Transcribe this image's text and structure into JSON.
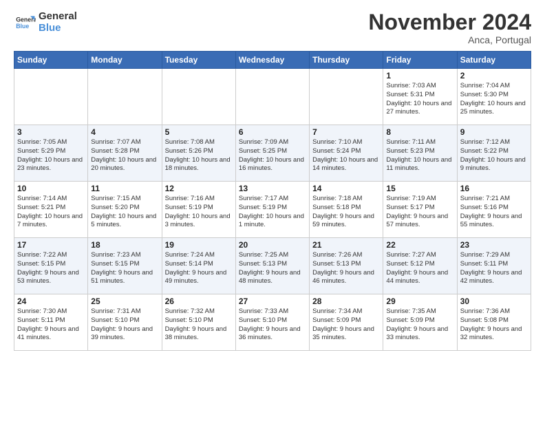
{
  "logo": {
    "line1": "General",
    "line2": "Blue"
  },
  "title": "November 2024",
  "location": "Anca, Portugal",
  "days_header": [
    "Sunday",
    "Monday",
    "Tuesday",
    "Wednesday",
    "Thursday",
    "Friday",
    "Saturday"
  ],
  "weeks": [
    [
      {
        "day": "",
        "info": ""
      },
      {
        "day": "",
        "info": ""
      },
      {
        "day": "",
        "info": ""
      },
      {
        "day": "",
        "info": ""
      },
      {
        "day": "",
        "info": ""
      },
      {
        "day": "1",
        "info": "Sunrise: 7:03 AM\nSunset: 5:31 PM\nDaylight: 10 hours and 27 minutes."
      },
      {
        "day": "2",
        "info": "Sunrise: 7:04 AM\nSunset: 5:30 PM\nDaylight: 10 hours and 25 minutes."
      }
    ],
    [
      {
        "day": "3",
        "info": "Sunrise: 7:05 AM\nSunset: 5:29 PM\nDaylight: 10 hours and 23 minutes."
      },
      {
        "day": "4",
        "info": "Sunrise: 7:07 AM\nSunset: 5:28 PM\nDaylight: 10 hours and 20 minutes."
      },
      {
        "day": "5",
        "info": "Sunrise: 7:08 AM\nSunset: 5:26 PM\nDaylight: 10 hours and 18 minutes."
      },
      {
        "day": "6",
        "info": "Sunrise: 7:09 AM\nSunset: 5:25 PM\nDaylight: 10 hours and 16 minutes."
      },
      {
        "day": "7",
        "info": "Sunrise: 7:10 AM\nSunset: 5:24 PM\nDaylight: 10 hours and 14 minutes."
      },
      {
        "day": "8",
        "info": "Sunrise: 7:11 AM\nSunset: 5:23 PM\nDaylight: 10 hours and 11 minutes."
      },
      {
        "day": "9",
        "info": "Sunrise: 7:12 AM\nSunset: 5:22 PM\nDaylight: 10 hours and 9 minutes."
      }
    ],
    [
      {
        "day": "10",
        "info": "Sunrise: 7:14 AM\nSunset: 5:21 PM\nDaylight: 10 hours and 7 minutes."
      },
      {
        "day": "11",
        "info": "Sunrise: 7:15 AM\nSunset: 5:20 PM\nDaylight: 10 hours and 5 minutes."
      },
      {
        "day": "12",
        "info": "Sunrise: 7:16 AM\nSunset: 5:19 PM\nDaylight: 10 hours and 3 minutes."
      },
      {
        "day": "13",
        "info": "Sunrise: 7:17 AM\nSunset: 5:19 PM\nDaylight: 10 hours and 1 minute."
      },
      {
        "day": "14",
        "info": "Sunrise: 7:18 AM\nSunset: 5:18 PM\nDaylight: 9 hours and 59 minutes."
      },
      {
        "day": "15",
        "info": "Sunrise: 7:19 AM\nSunset: 5:17 PM\nDaylight: 9 hours and 57 minutes."
      },
      {
        "day": "16",
        "info": "Sunrise: 7:21 AM\nSunset: 5:16 PM\nDaylight: 9 hours and 55 minutes."
      }
    ],
    [
      {
        "day": "17",
        "info": "Sunrise: 7:22 AM\nSunset: 5:15 PM\nDaylight: 9 hours and 53 minutes."
      },
      {
        "day": "18",
        "info": "Sunrise: 7:23 AM\nSunset: 5:15 PM\nDaylight: 9 hours and 51 minutes."
      },
      {
        "day": "19",
        "info": "Sunrise: 7:24 AM\nSunset: 5:14 PM\nDaylight: 9 hours and 49 minutes."
      },
      {
        "day": "20",
        "info": "Sunrise: 7:25 AM\nSunset: 5:13 PM\nDaylight: 9 hours and 48 minutes."
      },
      {
        "day": "21",
        "info": "Sunrise: 7:26 AM\nSunset: 5:13 PM\nDaylight: 9 hours and 46 minutes."
      },
      {
        "day": "22",
        "info": "Sunrise: 7:27 AM\nSunset: 5:12 PM\nDaylight: 9 hours and 44 minutes."
      },
      {
        "day": "23",
        "info": "Sunrise: 7:29 AM\nSunset: 5:11 PM\nDaylight: 9 hours and 42 minutes."
      }
    ],
    [
      {
        "day": "24",
        "info": "Sunrise: 7:30 AM\nSunset: 5:11 PM\nDaylight: 9 hours and 41 minutes."
      },
      {
        "day": "25",
        "info": "Sunrise: 7:31 AM\nSunset: 5:10 PM\nDaylight: 9 hours and 39 minutes."
      },
      {
        "day": "26",
        "info": "Sunrise: 7:32 AM\nSunset: 5:10 PM\nDaylight: 9 hours and 38 minutes."
      },
      {
        "day": "27",
        "info": "Sunrise: 7:33 AM\nSunset: 5:10 PM\nDaylight: 9 hours and 36 minutes."
      },
      {
        "day": "28",
        "info": "Sunrise: 7:34 AM\nSunset: 5:09 PM\nDaylight: 9 hours and 35 minutes."
      },
      {
        "day": "29",
        "info": "Sunrise: 7:35 AM\nSunset: 5:09 PM\nDaylight: 9 hours and 33 minutes."
      },
      {
        "day": "30",
        "info": "Sunrise: 7:36 AM\nSunset: 5:08 PM\nDaylight: 9 hours and 32 minutes."
      }
    ]
  ]
}
